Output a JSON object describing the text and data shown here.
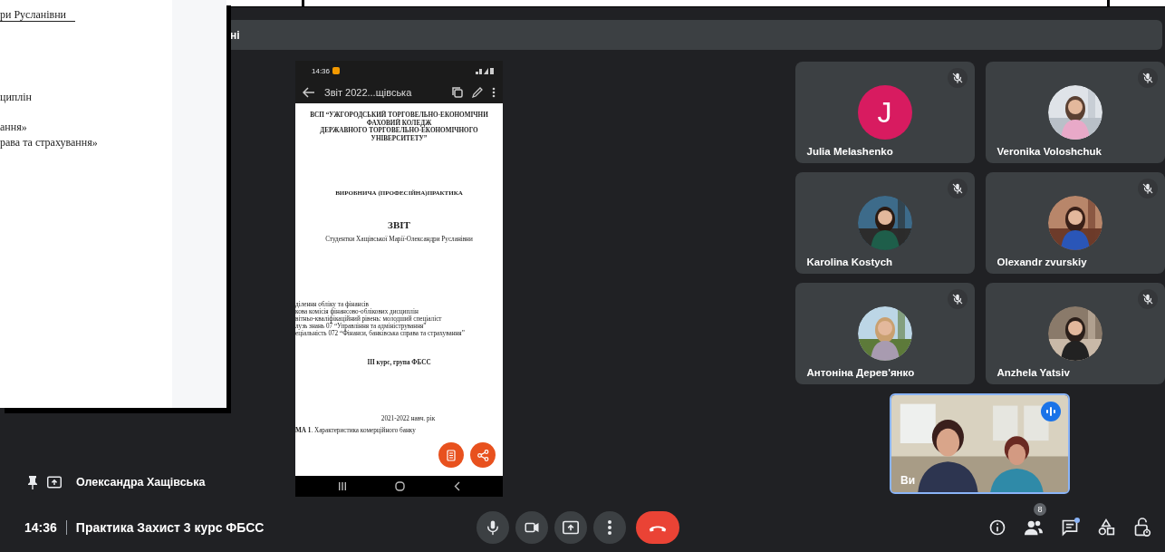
{
  "shared_document": {
    "lines": [
      {
        "text": "ри Русланівни",
        "kind": "underlined"
      },
      {
        "text": "циплін",
        "kind": "plain"
      },
      {
        "text": "ання»",
        "kind": "plain"
      },
      {
        "text": "рава та страхування»",
        "kind": "plain"
      }
    ]
  },
  "top_banner": {
    "text": "ні"
  },
  "presentation": {
    "status_time": "14:36",
    "doc_title": "Звіт 2022...щівська",
    "page": [
      {
        "kind": "header",
        "lines": [
          "ВСП “УЖГОРОДСЬКИЙ ТОРГОВЕЛЬНО-ЕКОНОМІЧНИ",
          "ФАХОВИЙ КОЛЕДЖ",
          "ДЕРЖАВНОГО ТОРГОВЕЛЬНО-ЕКОНОМІЧНОГО",
          "УНІВЕРСИТЕТУ”"
        ]
      },
      {
        "kind": "title",
        "text": "ВИРОБНИЧА (ПРОФЕСІЙНА)ПРАКТИКА"
      },
      {
        "kind": "big",
        "text": "ЗВІТ"
      },
      {
        "kind": "subtitle",
        "text": "Студентки Хащівської Марії-Олександри Русланівни"
      },
      {
        "kind": "details",
        "lines": [
          "ділення обліку та фінансів",
          "кова комісія фінансово-облікових дисциплін",
          "вітньо-кваліфікаційний рівень: молодший спеціаліст",
          "лузь знань 07 “Управління та адміністрування”",
          "еціальність 072 “Фінанси, банківська справа та страхування”"
        ]
      },
      {
        "kind": "group",
        "text": "ІІІ курс, група ФБСС"
      },
      {
        "kind": "year",
        "text": "2021-2022 навч. рік"
      },
      {
        "kind": "topic",
        "text": "**МА 1**. Характеристика комерційного банку"
      }
    ]
  },
  "presenter": {
    "name": "Олександра Хащівська"
  },
  "participants": [
    {
      "name": "Julia Melashenko",
      "initial": "J",
      "color": "#d81b60",
      "muted": true
    },
    {
      "name": "Veronika Voloshchuk",
      "muted": true
    },
    {
      "name": "Karolina Kostych",
      "muted": true
    },
    {
      "name": "Olexandr zvurskiy",
      "muted": true
    },
    {
      "name": "Антоніна Дерев'янко",
      "muted": true
    },
    {
      "name": "Anzhela Yatsiv",
      "muted": true
    }
  ],
  "self_view": {
    "label": "Ви",
    "speaking": true
  },
  "meeting": {
    "time": "14:36",
    "title": "Практика Захист 3 курс ФБСС"
  },
  "controls": [
    {
      "kind": "mic"
    },
    {
      "kind": "camera"
    },
    {
      "kind": "present"
    },
    {
      "kind": "more"
    },
    {
      "kind": "end"
    }
  ],
  "side_controls": [
    {
      "kind": "info"
    },
    {
      "kind": "people",
      "badge": "8"
    },
    {
      "kind": "chat",
      "notification": true
    },
    {
      "kind": "activities"
    },
    {
      "kind": "host"
    }
  ]
}
